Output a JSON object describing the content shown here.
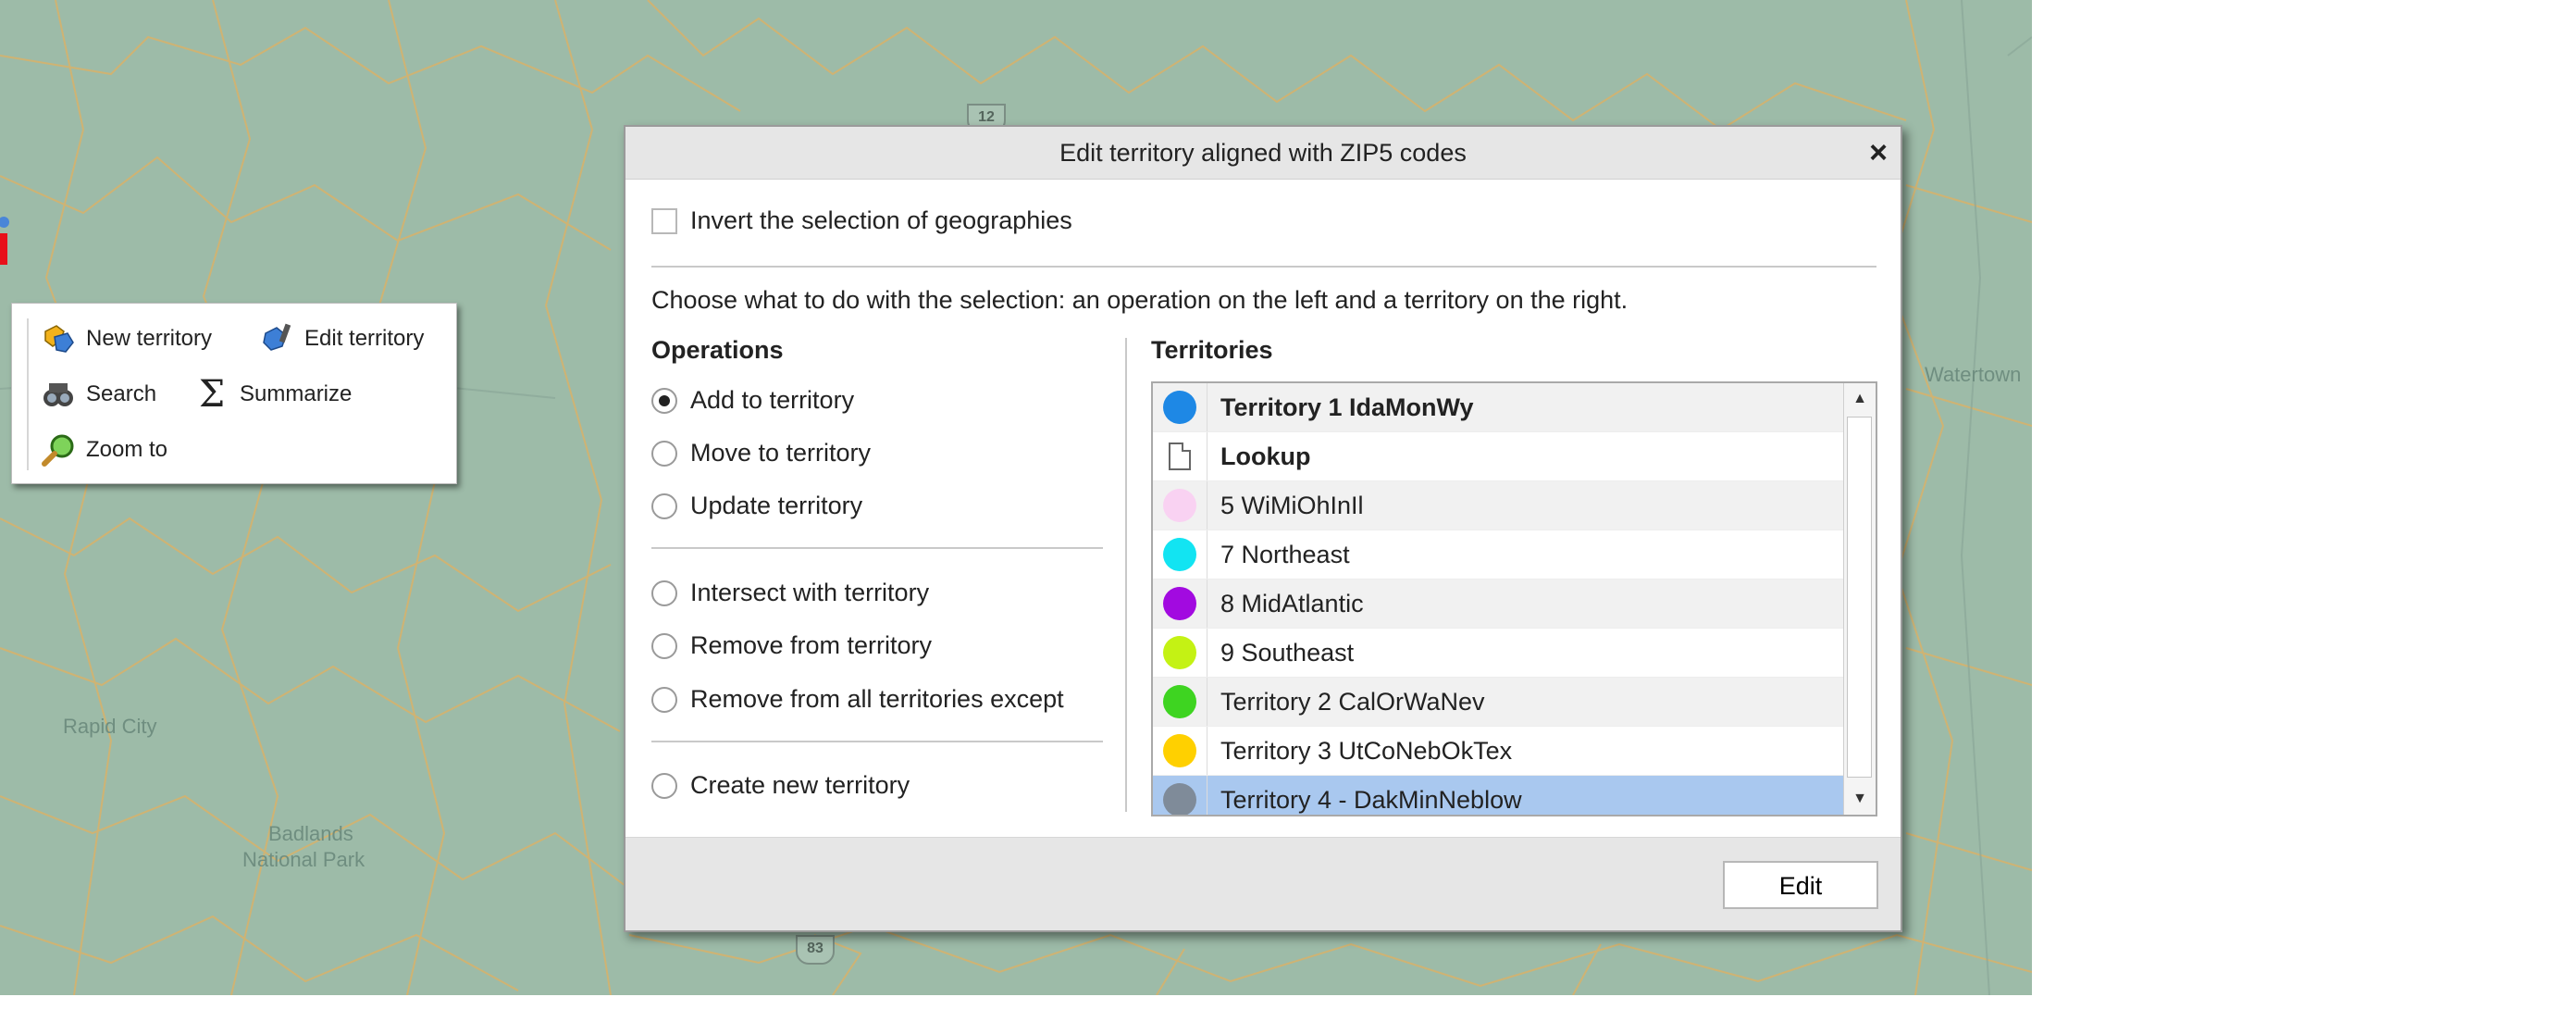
{
  "map": {
    "labels": [
      "Rapid City",
      "Badlands",
      "National Park",
      "Watertown"
    ],
    "shields": [
      "12",
      "83"
    ]
  },
  "toolbar": {
    "new_territory": "New territory",
    "edit_territory": "Edit territory",
    "search": "Search",
    "summarize": "Summarize",
    "zoom_to": "Zoom to"
  },
  "dialog": {
    "title": "Edit territory aligned with ZIP5 codes",
    "close": "×",
    "invert_label": "Invert the selection of geographies",
    "instructions": "Choose what to do with the selection: an operation on the left and a territory on the right.",
    "operations_title": "Operations",
    "territories_title": "Territories",
    "operations": [
      "Add to territory",
      "Move to territory",
      "Update territory",
      "Intersect with territory",
      "Remove from territory",
      "Remove from all territories except",
      "Create new territory"
    ],
    "selected_operation": "Add to territory",
    "territories": [
      {
        "name": "Territory  1 IdaMonWy",
        "color": "#1e88e5",
        "bold": true
      },
      {
        "name": "Lookup",
        "icon": "document-icon",
        "bold": true
      },
      {
        "name": "5 WiMiOhInIl",
        "color": "#f9d2f2"
      },
      {
        "name": "7 Northeast",
        "color": "#12e4f2"
      },
      {
        "name": "8 MidAtlantic",
        "color": "#a20ae0"
      },
      {
        "name": "9 Southeast",
        "color": "#c4f214"
      },
      {
        "name": "Territory 2 CalOrWaNev",
        "color": "#3ed421"
      },
      {
        "name": "Territory 3 UtCoNebOkTex",
        "color": "#ffd000"
      },
      {
        "name": "Territory 4 - DakMinNeblow",
        "color": "#7f8b99",
        "selected": true
      }
    ],
    "edit_button": "Edit"
  },
  "colors": {
    "map_bg": "#9dbba8",
    "boundary": "#d8b26a",
    "selected_row": "#a9c8ef"
  }
}
